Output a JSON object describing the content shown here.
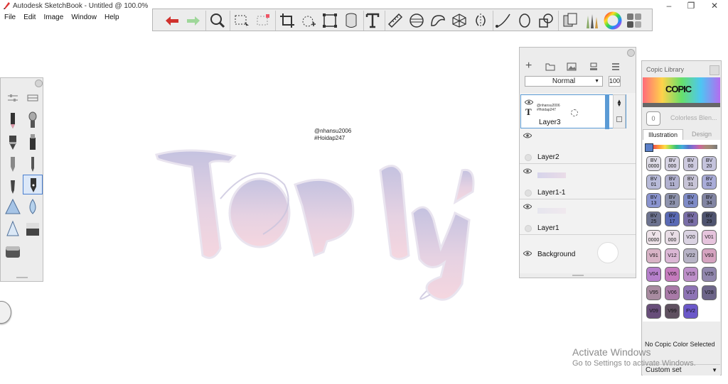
{
  "app": {
    "title": "Autodesk SketchBook - Untitled @ 100.0%",
    "menu": [
      "File",
      "Edit",
      "Image",
      "Window",
      "Help"
    ],
    "window_buttons": [
      "–",
      "❐",
      "✕"
    ]
  },
  "toolbar": {
    "tools": [
      "undo-icon",
      "redo-icon",
      "zoom-icon",
      "select-icon",
      "lasso-select-icon",
      "crop-icon",
      "transform-icon",
      "distort-icon",
      "flood-fill-icon",
      "text-tool-icon",
      "ruler-icon",
      "ellipse-guide-icon",
      "french-curve-icon",
      "perspective-icon",
      "symmetry-icon",
      "stroke-icon",
      "circle-tool-icon",
      "shapes-icon",
      "copy-paste-icon",
      "brush-library-icon",
      "color-wheel-icon",
      "palette-icon"
    ]
  },
  "canvas": {
    "watermark_line1": "@nhansu2006",
    "watermark_line2": "#Hoidap247",
    "lettering": "Top lý"
  },
  "layers": {
    "blend_mode": "Normal",
    "opacity": "100",
    "items": [
      {
        "name": "Layer3",
        "thumb_line1": "@nhansu2006",
        "thumb_line2": "#Hoidap247",
        "selected": true
      },
      {
        "name": "Layer2",
        "selected": false
      },
      {
        "name": "Layer1-1",
        "selected": false
      },
      {
        "name": "Layer1",
        "selected": false
      },
      {
        "name": "Background",
        "selected": false
      }
    ]
  },
  "copic": {
    "title": "Copic Library",
    "logo": "COPIC",
    "colorless_label": "Colorless Blen...",
    "colorless_code": "0",
    "tabs": [
      "Illustration",
      "Design"
    ],
    "swatches": [
      {
        "code": "BV\n0000",
        "color": "#dfdde8"
      },
      {
        "code": "BV\n000",
        "color": "#d6d3e3"
      },
      {
        "code": "BV\n00",
        "color": "#cdcadf"
      },
      {
        "code": "BV\n20",
        "color": "#c4c3dc"
      },
      {
        "code": "BV\n01",
        "color": "#b8bbd9"
      },
      {
        "code": "BV\n11",
        "color": "#b1b1cf"
      },
      {
        "code": "BV\n31",
        "color": "#c7c4d7"
      },
      {
        "code": "BV\n02",
        "color": "#a9acd8"
      },
      {
        "code": "BV\n13",
        "color": "#8a94cf"
      },
      {
        "code": "BV\n23",
        "color": "#8e93ad"
      },
      {
        "code": "BV\n04",
        "color": "#7f8bc7"
      },
      {
        "code": "BV\n34",
        "color": "#8285a3"
      },
      {
        "code": "BV\n25",
        "color": "#6d7390"
      },
      {
        "code": "BV\n17",
        "color": "#5a6ab5"
      },
      {
        "code": "BV\n08",
        "color": "#7a6fa8"
      },
      {
        "code": "BV\n29",
        "color": "#4f5470"
      },
      {
        "code": "V\n0000",
        "color": "#ede2e8"
      },
      {
        "code": "V\n000",
        "color": "#e8dde6"
      },
      {
        "code": "V20",
        "color": "#dad3e2"
      },
      {
        "code": "V01",
        "color": "#e6c4dd"
      },
      {
        "code": "V91",
        "color": "#d8b3c6"
      },
      {
        "code": "V12",
        "color": "#dbb7d5"
      },
      {
        "code": "V22",
        "color": "#b7b3c6"
      },
      {
        "code": "V93",
        "color": "#d5a3c0"
      },
      {
        "code": "V04",
        "color": "#b67fcb"
      },
      {
        "code": "V05",
        "color": "#c57bbd"
      },
      {
        "code": "V15",
        "color": "#bd8fc9"
      },
      {
        "code": "V25",
        "color": "#9187ad"
      },
      {
        "code": "V95",
        "color": "#a88ba0"
      },
      {
        "code": "V06",
        "color": "#a97aa8"
      },
      {
        "code": "V17",
        "color": "#8e74b5"
      },
      {
        "code": "V28",
        "color": "#6d6589"
      },
      {
        "code": "V09",
        "color": "#684e7a"
      },
      {
        "code": "V99",
        "color": "#5f5160"
      },
      {
        "code": "FV2",
        "color": "#6b58c9"
      }
    ],
    "status": "No Copic Color Selected",
    "set_label": "Custom set"
  },
  "os_overlay": {
    "line1": "Activate Windows",
    "line2": "Go to Settings to activate Windows."
  }
}
